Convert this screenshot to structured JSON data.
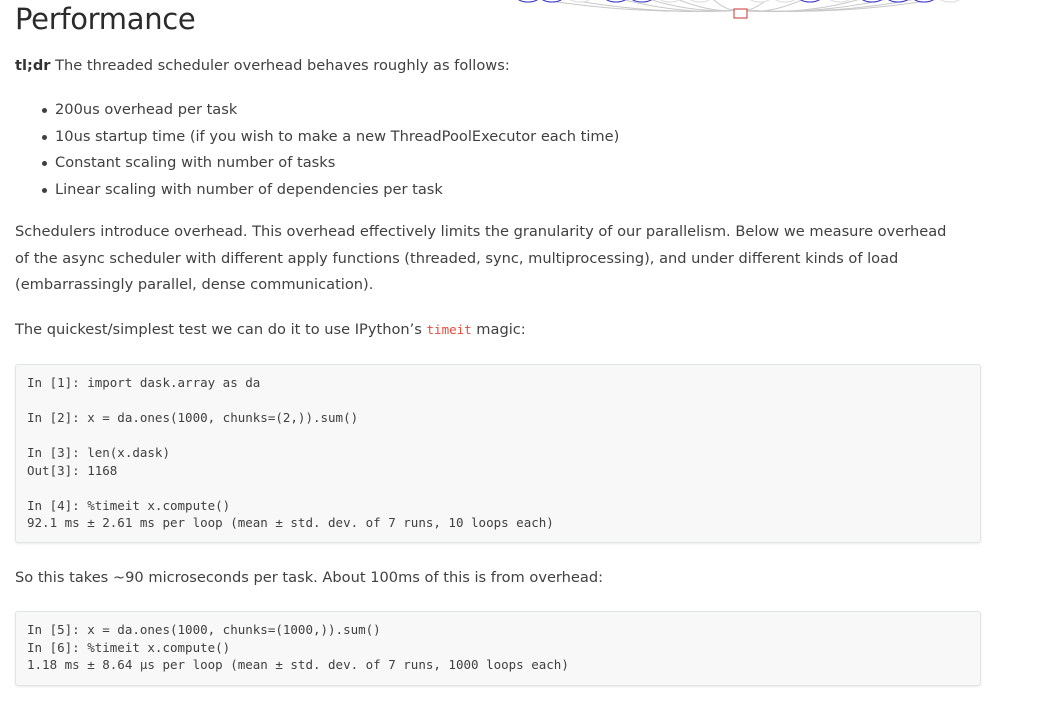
{
  "page": {
    "heading": "Performance"
  },
  "tldr": {
    "label": "tl;dr",
    "text": " The threaded scheduler overhead behaves roughly as follows:"
  },
  "bullets": [
    "200us overhead per task",
    "10us startup time (if you wish to make a new ThreadPoolExecutor each time)",
    "Constant scaling with number of tasks",
    "Linear scaling with number of dependencies per task"
  ],
  "intro_paragraph": "Schedulers introduce overhead. This overhead effectively limits the granularity of our parallelism. Below we measure overhead of the async scheduler with different apply functions (threaded, sync, multiprocessing), and under different kinds of load (embarrassingly parallel, dense communication).",
  "quick_paragraph": {
    "before": "The quickest/simplest test we can do it to use IPython’s ",
    "code": "timeit",
    "after": " magic:"
  },
  "code_block_1": "In [1]: import dask.array as da\n\nIn [2]: x = da.ones(1000, chunks=(2,)).sum()\n\nIn [3]: len(x.dask)\nOut[3]: 1168\n\nIn [4]: %timeit x.compute()\n92.1 ms ± 2.61 ms per loop (mean ± std. dev. of 7 runs, 10 loops each)",
  "after_paragraph": "So this takes ~90 microseconds per task. About 100ms of this is from overhead:",
  "code_block_2": "In [5]: x = da.ones(1000, chunks=(1000,)).sum()\nIn [6]: %timeit x.compute()\n1.18 ms ± 8.64 µs per loop (mean ± std. dev. of 7 runs, 1000 loops each)",
  "colors": {
    "text": "#404040",
    "code_background": "#f8f8f8",
    "inline_code": "#e74c3c",
    "graph_node_blue": "#3333cc",
    "graph_node_red": "#cc3333"
  }
}
